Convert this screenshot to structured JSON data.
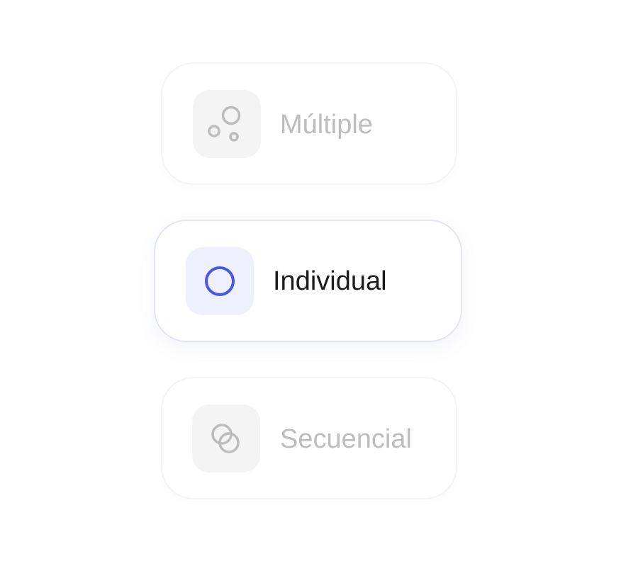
{
  "options": [
    {
      "label": "Múltiple",
      "icon": "multiple-circles-icon",
      "state": "inactive"
    },
    {
      "label": "Individual",
      "icon": "single-circle-icon",
      "state": "selected"
    },
    {
      "label": "Secuencial",
      "icon": "overlapping-circles-icon",
      "state": "inactive"
    }
  ],
  "colors": {
    "accent": "#4a57e6",
    "selected_tile": "#eff0fe",
    "selected_border": "#e3e4fb",
    "inactive_tile": "#f4f4f4",
    "inactive_icon": "#bcbcbc",
    "inactive_text": "#bdbdbd",
    "active_text": "#1c1c1e"
  }
}
